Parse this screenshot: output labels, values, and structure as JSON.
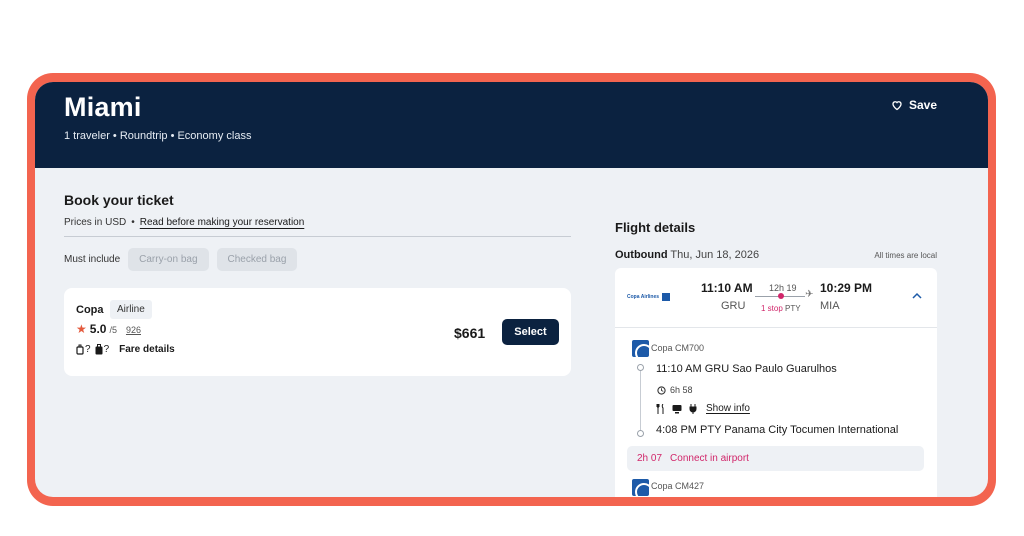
{
  "header": {
    "title": "Miami",
    "subtitle": "1 traveler • Roundtrip • Economy class",
    "save_label": "Save"
  },
  "booking": {
    "title": "Book your ticket",
    "prices_in": "Prices in USD",
    "bullet": "•",
    "read_link": "Read before making your reservation",
    "must_include": "Must include",
    "filters": [
      "Carry-on bag",
      "Checked bag"
    ]
  },
  "result": {
    "airline": "Copa",
    "airline_tag": "Airline",
    "rating": "5.0",
    "rating_out_of": "/5",
    "review_count": "926",
    "carry_on_q": "?",
    "checked_q": "?",
    "fare_details": "Fare details",
    "price": "$661",
    "select_label": "Select"
  },
  "flight_details": {
    "title": "Flight details",
    "outbound_label": "Outbound",
    "outbound_date": "Thu, Jun 18, 2026",
    "times_local": "All times are local",
    "summary": {
      "logo_text": "Copa Airlines",
      "dep_time": "11:10 AM",
      "dep_code": "GRU",
      "duration": "12h 19",
      "stops": "1 stop",
      "stop_code": "PTY",
      "arr_time": "10:29 PM",
      "arr_code": "MIA"
    },
    "segment1": {
      "flight_code": "Copa CM700",
      "dep": "11:10 AM  GRU Sao Paulo Guarulhos",
      "duration": "6h 58",
      "show_info": "Show info",
      "arr": "4:08 PM  PTY Panama City Tocumen International"
    },
    "connection": {
      "time": "2h 07",
      "text": "Connect in airport"
    },
    "segment2": {
      "flight_code": "Copa CM427"
    }
  }
}
